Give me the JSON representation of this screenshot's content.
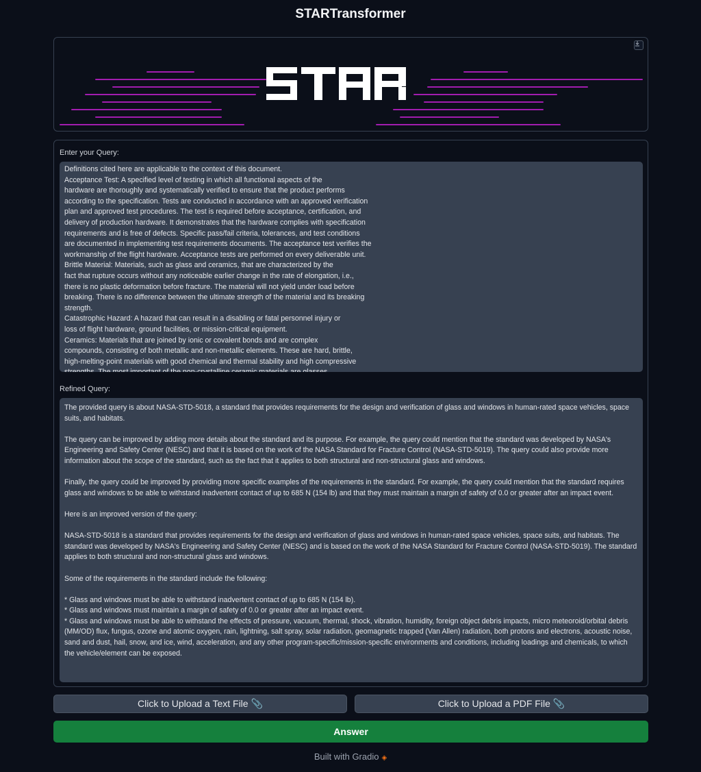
{
  "app": {
    "title": "STARTransformer"
  },
  "banner": {
    "logo_text": "STAR",
    "download_icon": "download-icon",
    "accent_color": "#c026d3"
  },
  "query": {
    "label": "Enter your Query:",
    "value": "Definitions cited here are applicable to the context of this document.\nAcceptance Test: A specified level of testing in which all functional aspects of the\nhardware are thoroughly and systematically verified to ensure that the product performs\naccording to the specification. Tests are conducted in accordance with an approved verification\nplan and approved test procedures. The test is required before acceptance, certification, and\ndelivery of production hardware. It demonstrates that the hardware complies with specification\nrequirements and is free of defects. Specific pass/fail criteria, tolerances, and test conditions\nare documented in implementing test requirements documents. The acceptance test verifies the\nworkmanship of the flight hardware. Acceptance tests are performed on every deliverable unit.\nBrittle Material: Materials, such as glass and ceramics, that are characterized by the\nfact that rupture occurs without any noticeable earlier change in the rate of elongation, i.e.,\nthere is no plastic deformation before fracture. The material will not yield under load before\nbreaking. There is no difference between the ultimate strength of the material and its breaking\nstrength.\nCatastrophic Hazard: A hazard that can result in a disabling or fatal personnel injury or\nloss of flight hardware, ground facilities, or mission-critical equipment.\nCeramics: Materials that are joined by ionic or covalent bonds and are complex\ncompounds, consisting of both metallic and non-metallic elements. These are hard, brittle,\nhigh-melting-point materials with good chemical and thermal stability and high compressive\nstrengths. The most important of the non-crystalline ceramic materials are glasses."
  },
  "refined": {
    "label": "Refined Query:",
    "value": "The provided query is about NASA-STD-5018, a standard that provides requirements for the design and verification of glass and windows in human-rated space vehicles, space suits, and habitats.\n\nThe query can be improved by adding more details about the standard and its purpose. For example, the query could mention that the standard was developed by NASA's Engineering and Safety Center (NESC) and that it is based on the work of the NASA Standard for Fracture Control (NASA-STD-5019). The query could also provide more information about the scope of the standard, such as the fact that it applies to both structural and non-structural glass and windows.\n\nFinally, the query could be improved by providing more specific examples of the requirements in the standard. For example, the query could mention that the standard requires glass and windows to be able to withstand inadvertent contact of up to 685 N (154 lb) and that they must maintain a margin of safety of 0.0 or greater after an impact event.\n\nHere is an improved version of the query:\n\nNASA-STD-5018 is a standard that provides requirements for the design and verification of glass and windows in human-rated space vehicles, space suits, and habitats. The standard was developed by NASA's Engineering and Safety Center (NESC) and is based on the work of the NASA Standard for Fracture Control (NASA-STD-5019). The standard applies to both structural and non-structural glass and windows.\n\nSome of the requirements in the standard include the following:\n\n* Glass and windows must be able to withstand inadvertent contact of up to 685 N (154 lb).\n* Glass and windows must maintain a margin of safety of 0.0 or greater after an impact event.\n* Glass and windows must be able to withstand the effects of pressure, vacuum, thermal, shock, vibration, humidity, foreign object debris impacts, micro meteoroid/orbital debris (MM/OD) flux, fungus, ozone and atomic oxygen, rain, lightning, salt spray, solar radiation, geomagnetic trapped (Van Allen) radiation, both protons and electrons, acoustic noise, sand and dust, hail, snow, and ice, wind, acceleration, and any other program-specific/mission-specific environments and conditions, including loadings and chemicals, to which the vehicle/element can be exposed."
  },
  "buttons": {
    "upload_text": "Click to Upload a Text File",
    "upload_pdf": "Click to Upload a PDF File",
    "clip_icon": "📎",
    "answer": "Answer",
    "answer_color": "#15803d"
  },
  "footer": {
    "text": "Built with Gradio",
    "logo_icon": "gradio-logo-icon"
  }
}
